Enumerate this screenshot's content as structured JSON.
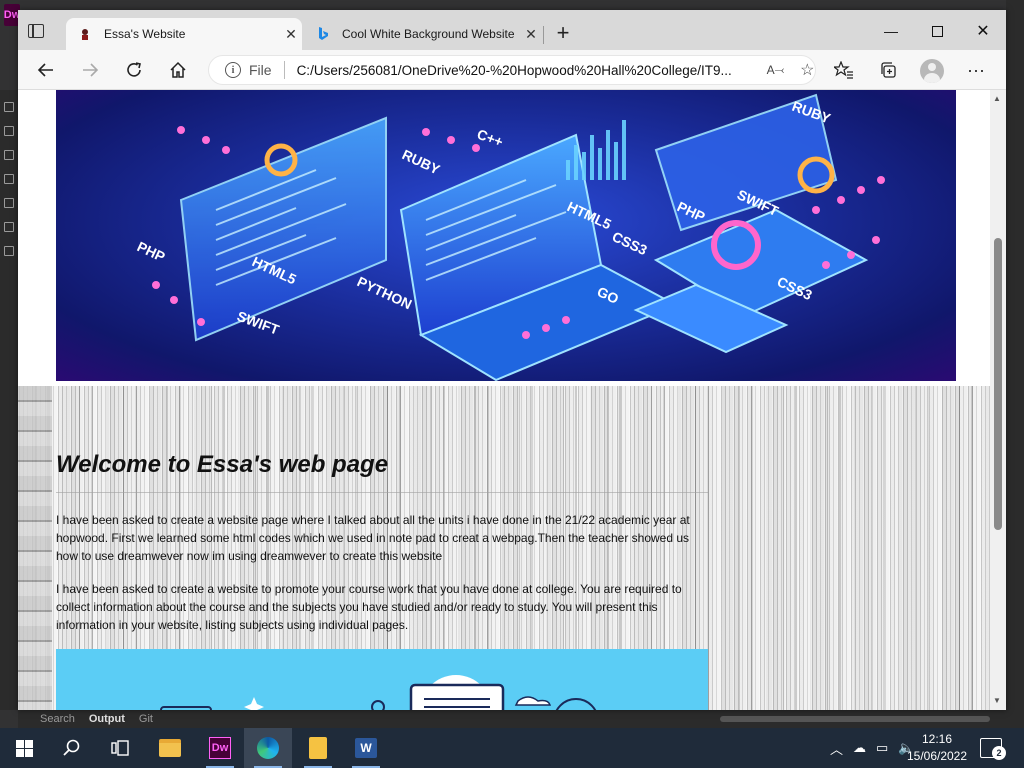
{
  "dreamweaver": {
    "logo": "Dw",
    "bottom_tabs": [
      "Search",
      "Output",
      "Git"
    ]
  },
  "browser": {
    "tabs": [
      {
        "title": "Essa's Website",
        "active": true
      },
      {
        "title": "Cool White Background Website",
        "active": false
      }
    ],
    "address": {
      "scheme": "File",
      "url": "C:/Users/256081/OneDrive%20-%20Hopwood%20Hall%20College/IT9..."
    },
    "read_aloud_icon": "A⤙"
  },
  "page": {
    "heading": "Welcome to Essa's web page",
    "paragraphs": [
      "I have been asked to create a website page where I talked about all the units i have done in the 21/22 academic year at hopwood. First we learned some html codes which we used in note pad to creat a webpag.Then the teacher showed us how to use dreamwever now im using dreamwever to create this website",
      "I have been asked to create a website to promote your course work that you have done at college. You are required to collect information about the course and the subjects you have studied and/or ready to study. You will present this information in your website, listing subjects using individual pages."
    ],
    "banner_labels": [
      "RUBY",
      "C++",
      "PHP",
      "HTML5",
      "PYTHON",
      "SWIFT",
      "CSS3",
      "GO",
      "PHP",
      "SWIFT",
      "CSS3",
      "RUBY",
      "HTML5"
    ]
  },
  "taskbar": {
    "apps": [
      "start",
      "search",
      "task-view",
      "file-explorer",
      "dreamweaver",
      "edge",
      "notes",
      "word"
    ],
    "time": "12:16",
    "date": "15/06/2022",
    "notifications": "2"
  },
  "colors": {
    "banner_dark": "#10176b",
    "banner_accent": "#2a4bd8",
    "taskbar": "#1f2b3a",
    "bottom_image": "#5bcdf5"
  }
}
